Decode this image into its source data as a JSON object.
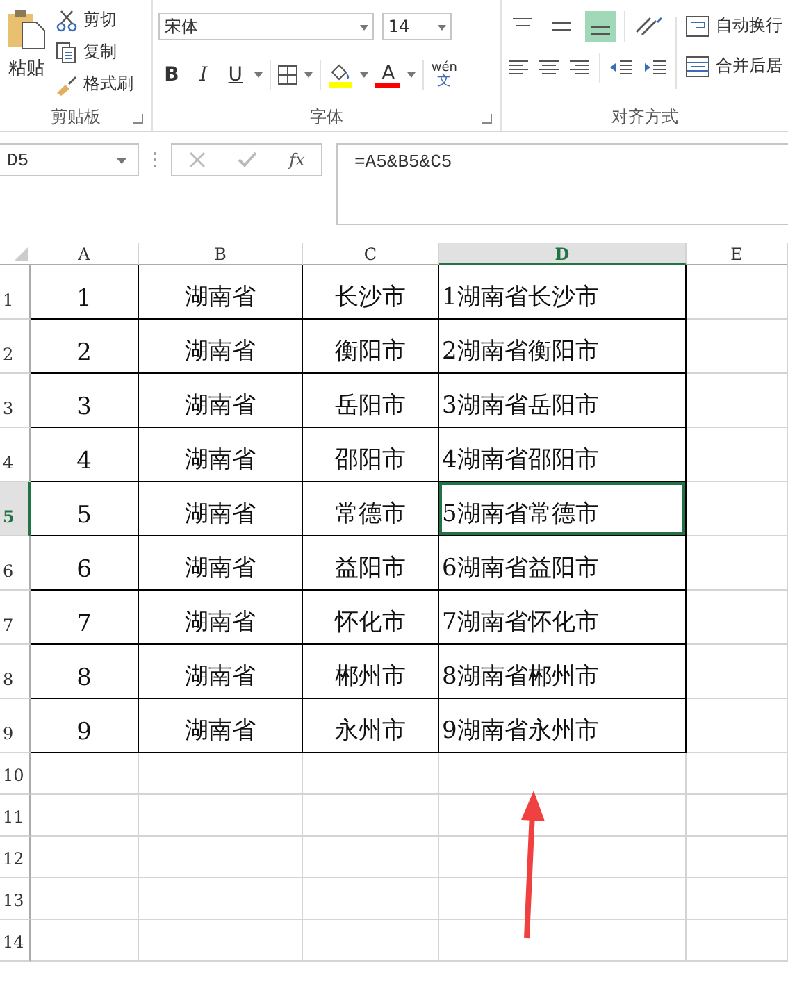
{
  "ribbon": {
    "clipboard": {
      "paste": "粘贴",
      "cut": "剪切",
      "copy": "复制",
      "format_painter": "格式刷",
      "label": "剪贴板"
    },
    "font": {
      "name": "宋体",
      "size": "14",
      "bold": "B",
      "italic": "I",
      "underline": "U",
      "font_color": "A",
      "phonetic_top": "wén",
      "phonetic_bottom": "文",
      "label": "字体"
    },
    "alignment": {
      "vertical": [
        {
          "kind": "top",
          "selected": false
        },
        {
          "kind": "middle",
          "selected": false
        },
        {
          "kind": "bottom",
          "selected": true
        }
      ],
      "wrap_text": "自动换行",
      "merge_center": "合并后居",
      "label": "对齐方式"
    }
  },
  "formula_bar": {
    "name_box": "D5",
    "fx": "fx",
    "formula": "=A5&B5&C5"
  },
  "sheet": {
    "columns": [
      {
        "label": "A",
        "selected": false
      },
      {
        "label": "B",
        "selected": false
      },
      {
        "label": "C",
        "selected": false
      },
      {
        "label": "D",
        "selected": true
      },
      {
        "label": "E",
        "selected": false
      }
    ],
    "rows": [
      {
        "header": "1",
        "selected": false,
        "cells": [
          {
            "text": "1",
            "selected": false
          },
          {
            "text": "湖南省",
            "selected": false
          },
          {
            "text": "长沙市",
            "selected": false
          },
          {
            "text": "1湖南省长沙市",
            "selected": false
          }
        ]
      },
      {
        "header": "2",
        "selected": false,
        "cells": [
          {
            "text": "2",
            "selected": false
          },
          {
            "text": "湖南省",
            "selected": false
          },
          {
            "text": "衡阳市",
            "selected": false
          },
          {
            "text": "2湖南省衡阳市",
            "selected": false
          }
        ]
      },
      {
        "header": "3",
        "selected": false,
        "cells": [
          {
            "text": "3",
            "selected": false
          },
          {
            "text": "湖南省",
            "selected": false
          },
          {
            "text": "岳阳市",
            "selected": false
          },
          {
            "text": "3湖南省岳阳市",
            "selected": false
          }
        ]
      },
      {
        "header": "4",
        "selected": false,
        "cells": [
          {
            "text": "4",
            "selected": false
          },
          {
            "text": "湖南省",
            "selected": false
          },
          {
            "text": "邵阳市",
            "selected": false
          },
          {
            "text": "4湖南省邵阳市",
            "selected": false
          }
        ]
      },
      {
        "header": "5",
        "selected": true,
        "cells": [
          {
            "text": "5",
            "selected": false
          },
          {
            "text": "湖南省",
            "selected": false
          },
          {
            "text": "常德市",
            "selected": false
          },
          {
            "text": "5湖南省常德市",
            "selected": true
          }
        ]
      },
      {
        "header": "6",
        "selected": false,
        "cells": [
          {
            "text": "6",
            "selected": false
          },
          {
            "text": "湖南省",
            "selected": false
          },
          {
            "text": "益阳市",
            "selected": false
          },
          {
            "text": "6湖南省益阳市",
            "selected": false
          }
        ]
      },
      {
        "header": "7",
        "selected": false,
        "cells": [
          {
            "text": "7",
            "selected": false
          },
          {
            "text": "湖南省",
            "selected": false
          },
          {
            "text": "怀化市",
            "selected": false
          },
          {
            "text": "7湖南省怀化市",
            "selected": false
          }
        ]
      },
      {
        "header": "8",
        "selected": false,
        "cells": [
          {
            "text": "8",
            "selected": false
          },
          {
            "text": "湖南省",
            "selected": false
          },
          {
            "text": "郴州市",
            "selected": false
          },
          {
            "text": "8湖南省郴州市",
            "selected": false
          }
        ]
      },
      {
        "header": "9",
        "selected": false,
        "cells": [
          {
            "text": "9",
            "selected": false
          },
          {
            "text": "湖南省",
            "selected": false
          },
          {
            "text": "永州市",
            "selected": false
          },
          {
            "text": "9湖南省永州市",
            "selected": false
          }
        ]
      },
      {
        "header": "10",
        "selected": false
      },
      {
        "header": "11",
        "selected": false
      },
      {
        "header": "12",
        "selected": false
      },
      {
        "header": "13",
        "selected": false
      },
      {
        "header": "14",
        "selected": false
      }
    ]
  }
}
